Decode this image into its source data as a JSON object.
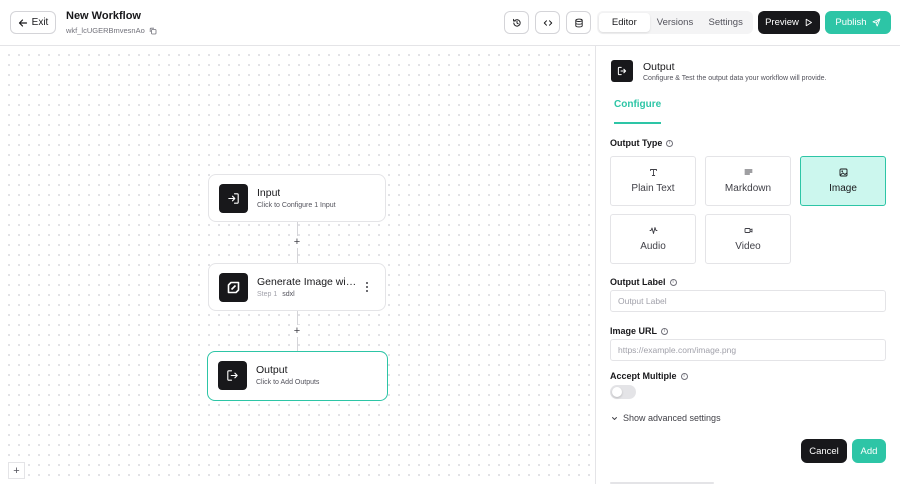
{
  "header": {
    "exit_label": "Exit",
    "workflow_title": "New Workflow",
    "workflow_id": "wkf_lcUGERBmvesnAo",
    "tabs": [
      {
        "label": "Editor",
        "active": true
      },
      {
        "label": "Versions",
        "active": false
      },
      {
        "label": "Settings",
        "active": false
      }
    ],
    "preview_label": "Preview",
    "publish_label": "Publish",
    "icons": [
      "history-icon",
      "code-icon",
      "database-icon"
    ]
  },
  "canvas": {
    "nodes": [
      {
        "title": "Input",
        "subtitle": "Click to Configure 1 Input",
        "icon": "input-icon"
      },
      {
        "title": "Generate Image wit...",
        "step": "Step 1",
        "model": "sdxl",
        "icon": "model-logo-icon"
      },
      {
        "title": "Output",
        "subtitle": "Click to Add Outputs",
        "icon": "output-icon",
        "selected": true
      }
    ],
    "add_symbol": "+",
    "zoom_symbol": "+"
  },
  "panel": {
    "title": "Output",
    "description": "Configure & Test the output data your workflow will provide.",
    "tab": "Configure",
    "output_type_label": "Output Type",
    "output_types": [
      {
        "label": "Plain Text",
        "icon": "text-icon",
        "selected": false
      },
      {
        "label": "Markdown",
        "icon": "markdown-icon",
        "selected": false
      },
      {
        "label": "Image",
        "icon": "image-icon",
        "selected": true
      },
      {
        "label": "Audio",
        "icon": "audio-icon",
        "selected": false
      },
      {
        "label": "Video",
        "icon": "video-icon",
        "selected": false
      }
    ],
    "output_label_label": "Output Label",
    "output_label_placeholder": "Output Label",
    "output_label_value": "",
    "image_url_label": "Image URL",
    "image_url_placeholder": "https://example.com/image.png",
    "image_url_value": "",
    "accept_multiple_label": "Accept Multiple",
    "accept_multiple": false,
    "advanced_label": "Show advanced settings",
    "cancel_label": "Cancel",
    "add_label": "Add"
  },
  "colors": {
    "accent": "#2dc5a6",
    "accent_light": "#ccf7ee",
    "dark": "#18181b"
  }
}
